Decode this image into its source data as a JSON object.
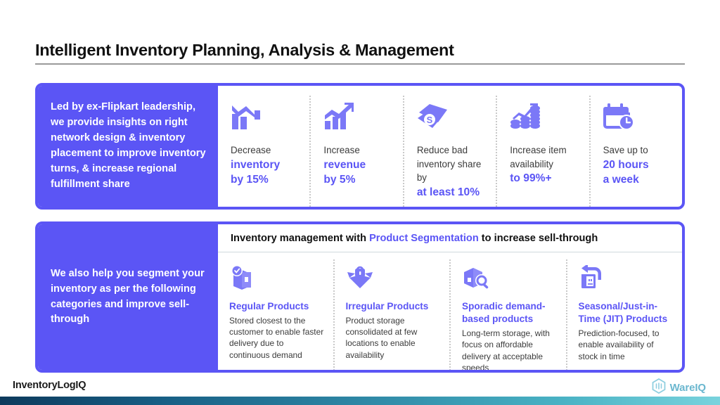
{
  "title": "Intelligent Inventory Planning, Analysis & Management",
  "theme": {
    "accent": "#5B55F5",
    "body_text": "#3b3b3b",
    "heading_text": "#111111",
    "divider": "#c9c9c9",
    "wareiq_blue": "#6bb7cf"
  },
  "panel_one": {
    "aside_text": "Led by ex-Flipkart leadership, we provide insights on right network design & inventory placement to improve inventory turns, & increase regional fulfillment share",
    "stats": [
      {
        "icon": "bar-chart-down-icon",
        "lead": "Decrease",
        "accent_line1": "inventory",
        "accent_line2": "by 15%"
      },
      {
        "icon": "bar-chart-up-icon",
        "lead": "Increase",
        "accent_line1": "revenue",
        "accent_line2": "by 5%"
      },
      {
        "icon": "money-bills-icon",
        "lead": "Reduce bad inventory share by",
        "accent_line1": "at least 10%",
        "accent_line2": ""
      },
      {
        "icon": "coins-growth-icon",
        "lead": "Increase item availability",
        "accent_line1": "to 99%+",
        "accent_line2": ""
      },
      {
        "icon": "calendar-clock-icon",
        "lead": "Save up to",
        "accent_line1": "20 hours",
        "accent_line2": "a week"
      }
    ]
  },
  "panel_two": {
    "aside_text": "We also help you segment your inventory as per the following categories and improve sell-through",
    "header": {
      "before": "Inventory management with ",
      "accent": "Product Segmentation",
      "after": " to increase sell-through"
    },
    "segments": [
      {
        "icon": "box-check-icon",
        "title": "Regular Products",
        "desc": "Stored closest to the customer to enable faster delivery due to continuous demand"
      },
      {
        "icon": "box-lock-icon",
        "title": "Irregular Products",
        "desc": "Product storage consolidated at few locations to enable availability"
      },
      {
        "icon": "box-search-icon",
        "title": "Sporadic demand-based products",
        "desc": "Long-term storage, with focus on affordable delivery at acceptable speeds"
      },
      {
        "icon": "box-return-icon",
        "title": "Seasonal/Just-in-Time (JIT) Products",
        "desc": "Prediction-focused, to enable availability of stock in time"
      }
    ]
  },
  "footer": {
    "brand": "InventoryLogIQ",
    "partner": "WareIQ"
  }
}
